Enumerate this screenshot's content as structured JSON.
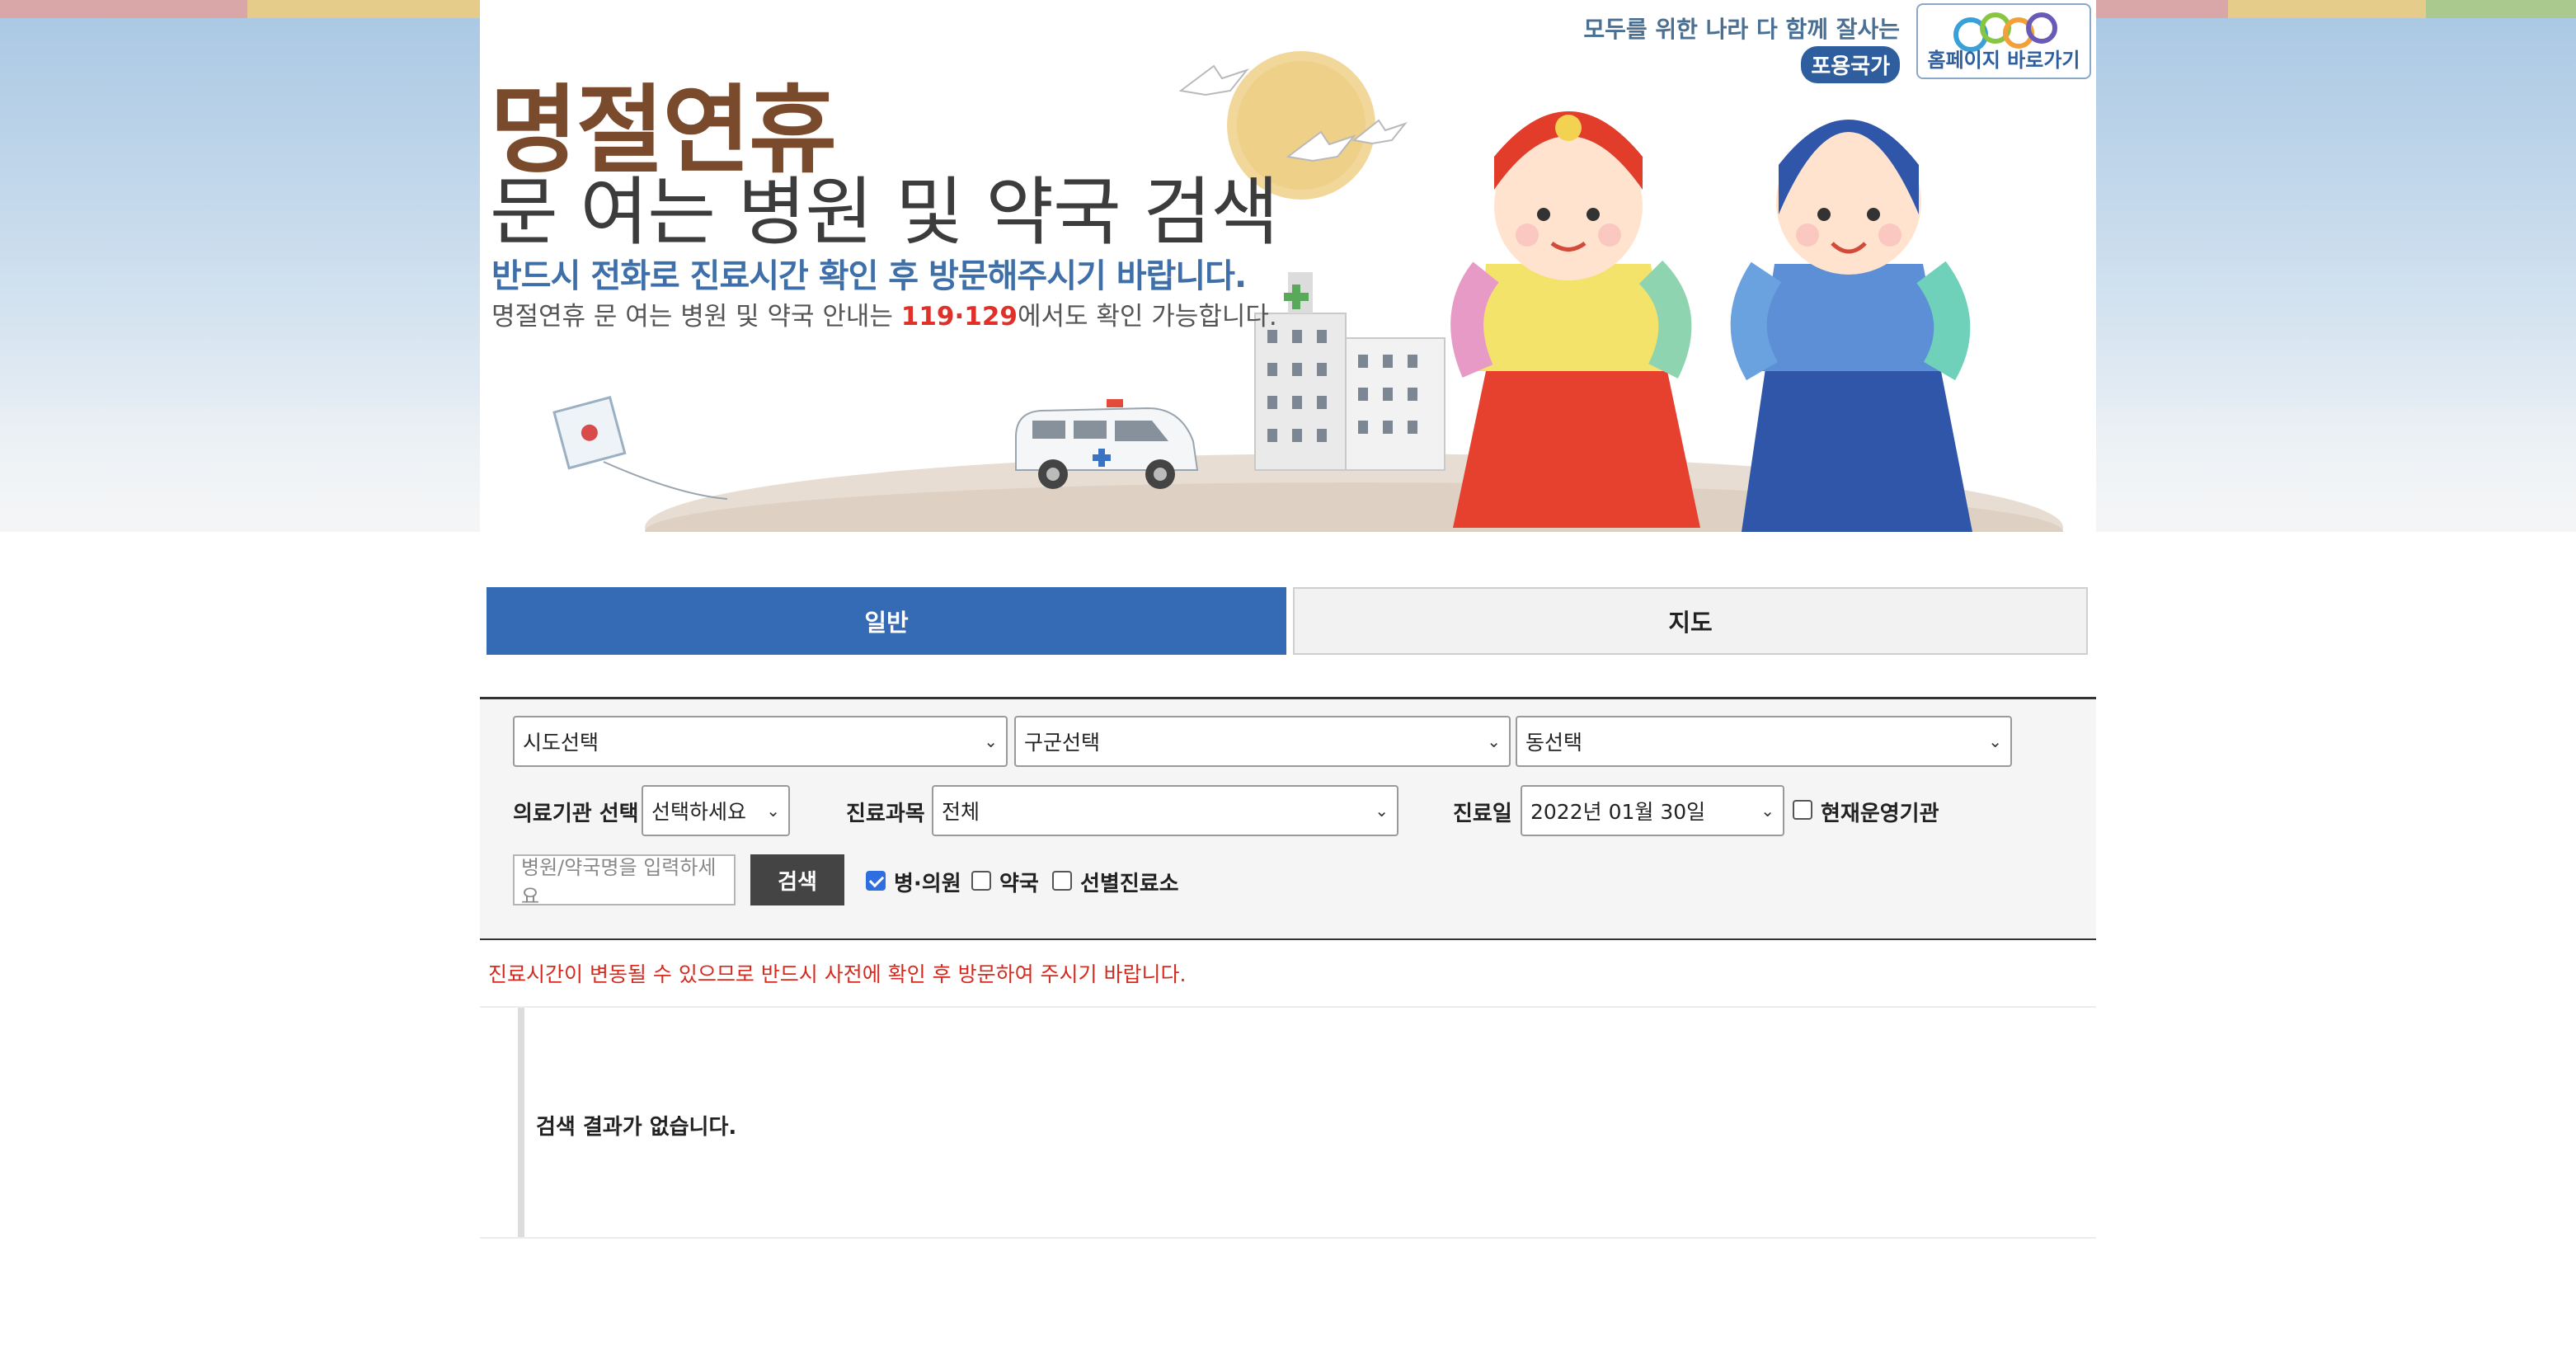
{
  "banner": {
    "title": "명절연휴",
    "subtitle": "문 여는 병원 및 약국 검색",
    "note_primary": "반드시 전화로 진료시간 확인 후 방문해주시기 바랍니다.",
    "note_secondary_prefix": "명절연휴 문 여는 병원 및 약국 안내는 ",
    "note_secondary_highlight": "119·129",
    "note_secondary_suffix": "에서도 확인 가능합니다.",
    "motto": "모두를 위한 나라 다 함께 잘사는",
    "motto_badge": "포용국가",
    "home_link_label": "홈페이지 바로가기"
  },
  "tabs": [
    {
      "label": "일반",
      "active": true
    },
    {
      "label": "지도",
      "active": false
    }
  ],
  "search": {
    "sido": "시도선택",
    "gugun": "구군선택",
    "dong": "동선택",
    "institution_label": "의료기관 선택",
    "institution_value": "선택하세요",
    "department_label": "진료과목",
    "department_value": "전체",
    "date_label": "진료일",
    "date_value": "2022년 01월 30일",
    "open_now_label": "현재운영기관",
    "open_now_checked": false,
    "name_placeholder": "병원/약국명을 입력하세요",
    "search_button": "검색",
    "types": [
      {
        "label": "병·의원",
        "checked": true
      },
      {
        "label": "약국",
        "checked": false
      },
      {
        "label": "선별진료소",
        "checked": false
      }
    ]
  },
  "notice": "진료시간이 변동될 수 있으므로 반드시 사전에 확인 후 방문하여 주시기 바랍니다.",
  "result": {
    "empty_message": "검색 결과가 없습니다."
  },
  "colors": {
    "tab_active": "#356bb5",
    "notice": "#d62a1e",
    "title_brown": "#7a4a2c",
    "note_blue": "#3f6fa8",
    "highlight_red": "#e0302a"
  }
}
